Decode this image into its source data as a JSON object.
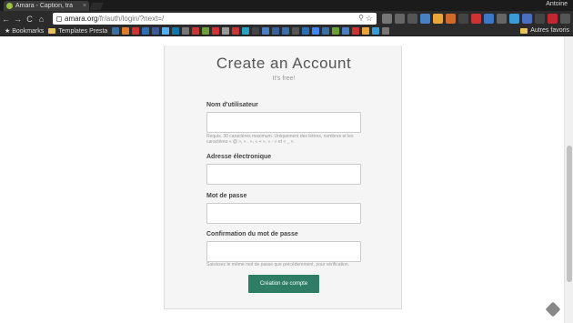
{
  "browser": {
    "tab_title": "Amara - Caption, tra",
    "tab_close": "×",
    "user_name": "Antoine",
    "url_host": "amara.org",
    "url_path": "/fr/auth/login/?next=/",
    "back": "←",
    "forward": "→",
    "reload": "C",
    "home": "⌂",
    "star": "☆",
    "key": "⚲"
  },
  "bookmarks_bar": {
    "bookmarks_label": "Bookmarks",
    "templates_label": "Templates Presta",
    "other_label": "Autres favoris"
  },
  "form": {
    "title": "Create an Account",
    "subtitle": "It's free!",
    "username_label": "Nom d'utilisateur",
    "username_value": "",
    "username_help": "Requis. 30 caractères maximum. Uniquement des lettres, nombres et les caractères « @ », « . », « + », « - » et « _ ».",
    "email_label": "Adresse électronique",
    "email_value": "",
    "password_label": "Mot de passe",
    "password_value": "",
    "confirm_label": "Confirmation du mot de passe",
    "confirm_value": "",
    "confirm_help": "Saisissez le même mot de passe que précédemment, pour vérification.",
    "submit_label": "Création de compte"
  },
  "colors": {
    "button": "#2f7d64",
    "card_bg": "#f5f5f5"
  }
}
